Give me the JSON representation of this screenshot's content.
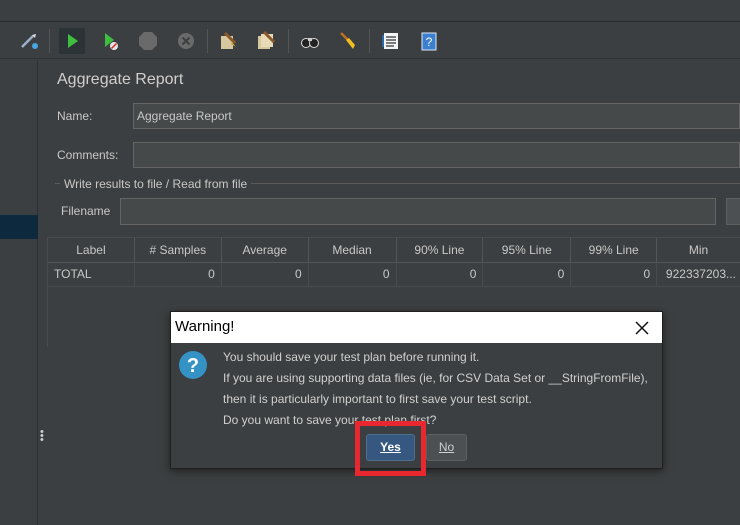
{
  "toolbar": {
    "icons": [
      "start-remote-icon",
      "start-icon",
      "start-no-pauses-icon",
      "stop-icon",
      "shutdown-icon",
      "clear-icon",
      "clear-all-icon",
      "search-icon",
      "reset-search-icon",
      "function-helper-icon",
      "help-icon"
    ]
  },
  "report": {
    "title": "Aggregate Report",
    "name_label": "Name:",
    "name_value": "Aggregate Report",
    "comments_label": "Comments:",
    "comments_value": "",
    "group_title": "Write results to file / Read from file",
    "filename_label": "Filename",
    "filename_value": ""
  },
  "table": {
    "columns": [
      "Label",
      "# Samples",
      "Average",
      "Median",
      "90% Line",
      "95% Line",
      "99% Line",
      "Min"
    ],
    "rows": [
      [
        "TOTAL",
        "0",
        "0",
        "0",
        "0",
        "0",
        "0",
        "922337203..."
      ]
    ]
  },
  "dialog": {
    "title": "Warning!",
    "lines": [
      "You should save your test plan before running it.",
      "If you are using supporting data files (ie, for CSV Data Set or __StringFromFile),",
      "then it is particularly important to first save your test script.",
      "Do you want to save your test plan first?"
    ],
    "yes_label": "Yes",
    "no_label": "No"
  },
  "colors": {
    "background": "#3c3f41",
    "selection": "#0d293e",
    "accent_button": "#365880",
    "highlight_box": "#e8282e",
    "question_icon": "#3592c4"
  }
}
